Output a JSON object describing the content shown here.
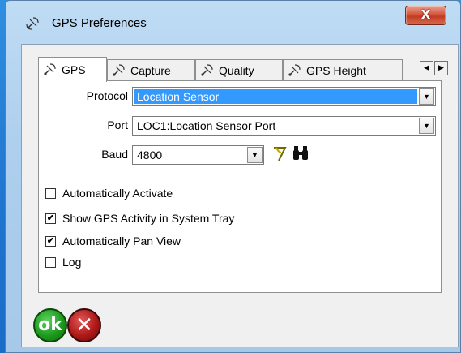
{
  "window": {
    "title": "GPS Preferences",
    "close_label": "X"
  },
  "tabs": [
    {
      "label": "GPS",
      "active": true
    },
    {
      "label": "Capture",
      "active": false
    },
    {
      "label": "Quality",
      "active": false
    },
    {
      "label": "GPS Height",
      "active": false
    }
  ],
  "tab_scroll": {
    "left": "◀",
    "right": "▶"
  },
  "form": {
    "protocol_label": "Protocol",
    "protocol_value": "Location Sensor",
    "port_label": "Port",
    "port_value": "LOC1:Location Sensor Port",
    "baud_label": "Baud",
    "baud_value": "4800",
    "dropdown_arrow": "▼"
  },
  "options": [
    {
      "label": "Automatically Activate",
      "checked": false
    },
    {
      "label": "Show GPS Activity in System Tray",
      "checked": true
    },
    {
      "label": "Automatically Pan View",
      "checked": true
    },
    {
      "label": "Log",
      "checked": false
    }
  ],
  "buttons": {
    "ok_label": "ok",
    "cancel_label": "✕"
  },
  "colors": {
    "selection": "#3399ff",
    "ok_green": "#1e9a1e",
    "cancel_red": "#b01818"
  }
}
